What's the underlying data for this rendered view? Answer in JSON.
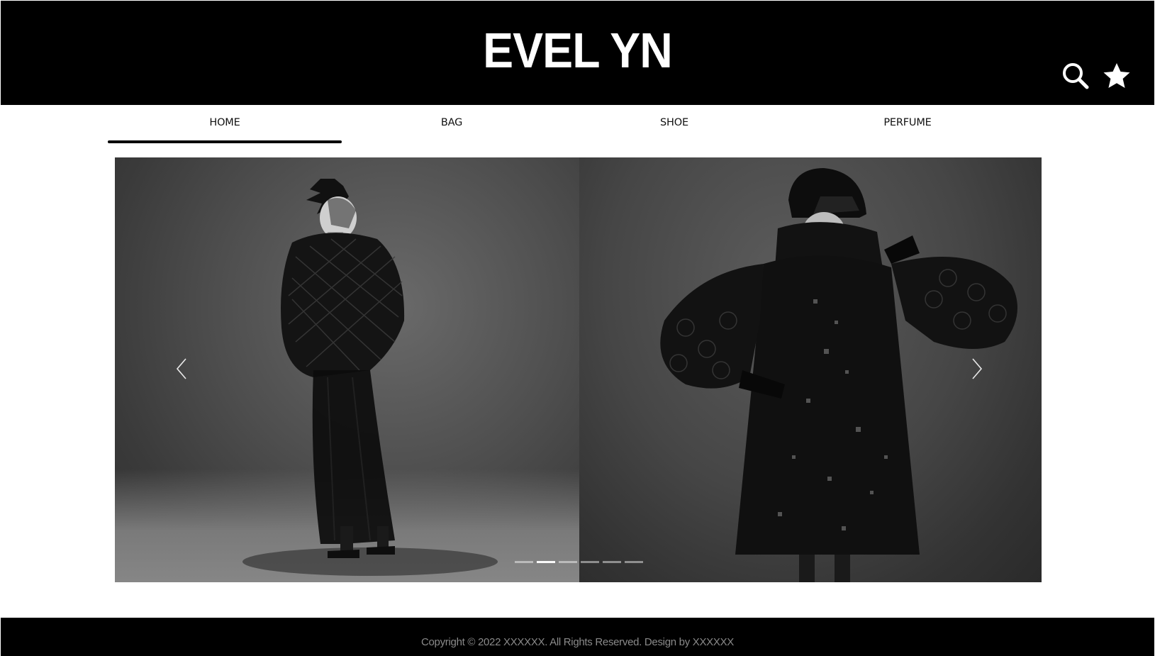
{
  "header": {
    "logo": "EVEL YN",
    "search_icon": "search-icon",
    "favorites_icon": "star-icon"
  },
  "nav": {
    "items": [
      {
        "label": "HOME",
        "active": true
      },
      {
        "label": "BAG",
        "active": false
      },
      {
        "label": "SHOE",
        "active": false
      },
      {
        "label": "PERFUME",
        "active": false
      }
    ]
  },
  "slider": {
    "prev_icon": "chevron-left-icon",
    "next_icon": "chevron-right-icon",
    "slide_count": 6,
    "active_slide": 2
  },
  "footer": {
    "copyright": "Copyright © 2022 XXXXXX.   All Rights Reserved. Design by XXXXXX"
  },
  "colors": {
    "header_bg": "#000000",
    "footer_bg": "#000000",
    "page_bg": "#ffffff",
    "footer_text": "#8a8a8a"
  }
}
